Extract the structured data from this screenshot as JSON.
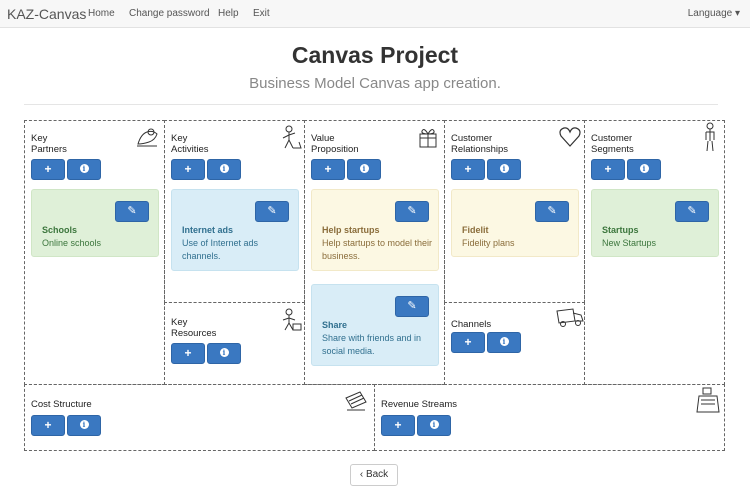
{
  "nav": {
    "brand": "KAZ-Canvas",
    "links": [
      "Home",
      "Change password",
      "Help",
      "Exit"
    ],
    "language": "Language ▾"
  },
  "header": {
    "title": "Canvas Project",
    "subtitle": "Business Model Canvas app creation."
  },
  "buttons": {
    "add": "+",
    "info": "i",
    "edit": "✎"
  },
  "canvas": {
    "key_partners": {
      "label_1": "Key",
      "label_2": "Partners",
      "icon": "handshake-icon"
    },
    "key_activities": {
      "label_1": "Key",
      "label_2": "Activities",
      "icon": "worker-icon"
    },
    "key_resources": {
      "label_1": "Key",
      "label_2": "Resources",
      "icon": "worker-icon"
    },
    "value_proposition": {
      "label_1": "Value",
      "label_2": "Proposition",
      "icon": "gift-icon"
    },
    "customer_relationships": {
      "label_1": "Customer",
      "label_2": "Relationships",
      "icon": "heart-icon"
    },
    "channels": {
      "label": "Channels",
      "icon": "truck-icon"
    },
    "customer_segments": {
      "label_1": "Customer",
      "label_2": "Segments",
      "icon": "person-icon"
    },
    "cost_structure": {
      "label": "Cost Structure",
      "icon": "money-icon"
    },
    "revenue_streams": {
      "label": "Revenue Streams",
      "icon": "cash-register-icon"
    }
  },
  "notes": {
    "schools": {
      "title": "Schools",
      "text": "Online schools",
      "color": "#dff0d8"
    },
    "internet_ads": {
      "title": "Internet ads",
      "text": "Use of Internet ads channels.",
      "color": "#d9edf7"
    },
    "help_startups": {
      "title": "Help startups",
      "text": "Help startups to model their business.",
      "color": "#fcf8e3"
    },
    "share": {
      "title": "Share",
      "text": "Share with friends and in social media.",
      "color": "#d9edf7"
    },
    "fidelit": {
      "title": "Fidelit",
      "text": "Fidelity plans",
      "color": "#fcf8e3"
    },
    "startups": {
      "title": "Startups",
      "text": "New Startups",
      "color": "#dff0d8"
    }
  },
  "footer": {
    "back": "Back",
    "back_icon": "chevron-left-icon"
  },
  "colors": {
    "primary": "#3a78c1",
    "navbar": "#f7f7f7"
  }
}
